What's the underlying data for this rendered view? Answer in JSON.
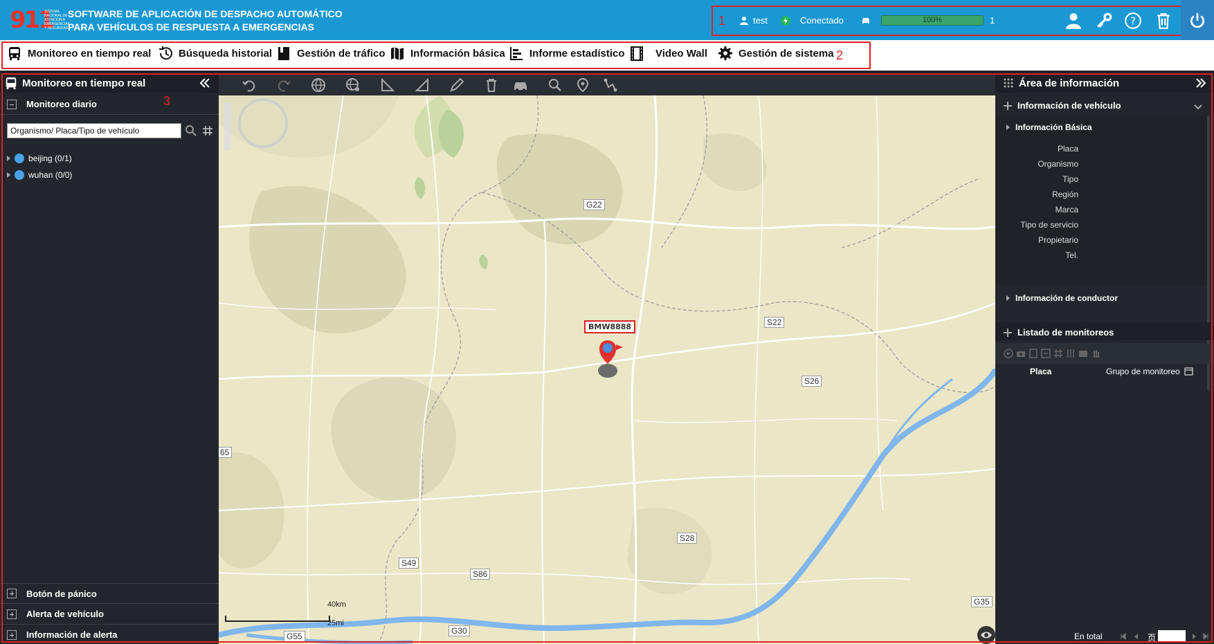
{
  "header": {
    "logo_number": "911",
    "logo_subtext": "SISTEMA NACIONAL DE ATENCION A EMERGENCIAS Y SEGURIDAD",
    "title_line1": "SOFTWARE DE APLICACIÓN DE DESPACHO AUTOMÁTICO",
    "title_line2": "PARA VEHÍCULOS DE RESPUESTA A EMERGENCIAS",
    "user": "test",
    "connection_status": "Conectado",
    "progress_label": "100%",
    "progress_value": 100,
    "vehicle_count": "1",
    "annotation_number": "1"
  },
  "nav": {
    "annotation_number": "2",
    "items": [
      {
        "label": "Monitoreo en tiempo real"
      },
      {
        "label": "Búsqueda historial"
      },
      {
        "label": "Gestión de tráfico"
      },
      {
        "label": "Información básica"
      },
      {
        "label": "Informe estadístico"
      },
      {
        "label": "Video Wall"
      },
      {
        "label": "Gestión de sistema"
      }
    ]
  },
  "left_panel": {
    "title": "Monitoreo en tiempo real",
    "annotation_number": "3",
    "section_daily": "Monitoreo diario",
    "search_placeholder": "Organismo/ Placa/Tipo de vehículo",
    "tree": [
      {
        "label": "beijing (0/1)"
      },
      {
        "label": "wuhan (0/0)"
      }
    ],
    "bottom_sections": [
      "Botón de pánico",
      "Alerta de vehículo",
      "Información de alerta"
    ]
  },
  "map": {
    "vehicle_label": "BMW8888",
    "roads": [
      "G22",
      "S22",
      "S26",
      "S28",
      "S49",
      "S86",
      "G30",
      "G55",
      "G35",
      "65"
    ],
    "scale_km": "40km",
    "scale_mi": "25mi"
  },
  "right_panel": {
    "title": "Área de información",
    "vehicle_info_title": "Información de vehículo",
    "basic_info_title": "Información Básica",
    "fields": [
      "Placa",
      "Organismo",
      "Tipo",
      "Región",
      "Marca",
      "Tipo de servicio",
      "Propietario",
      "Tel."
    ],
    "driver_info_title": "Información de conductor",
    "monitor_list_title": "Listado de monitoreos",
    "col_plate": "Placa",
    "col_group": "Grupo de monitoreo",
    "footer_total": "En total",
    "footer_page": "页"
  },
  "colors": {
    "header_bg": "#1998d4",
    "accent_red": "#e02020",
    "panel_bg": "#23272d",
    "map_bg": "#ebe6c6",
    "river": "#7fb6ec"
  }
}
